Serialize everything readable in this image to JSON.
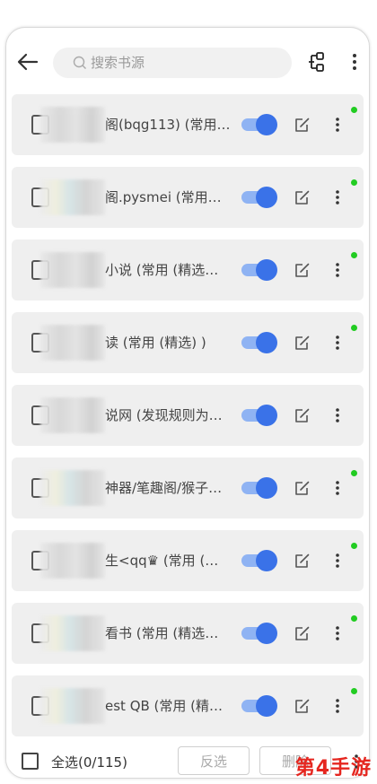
{
  "search": {
    "placeholder": "搜索书源"
  },
  "sources": [
    {
      "name": "阁(bqg113) (常用…",
      "enabled": true,
      "status_dot": true
    },
    {
      "name": "阁.pysmei (常用…",
      "enabled": true,
      "status_dot": true
    },
    {
      "name": "小说 (常用 (精选…",
      "enabled": true,
      "status_dot": true
    },
    {
      "name": "读 (常用 (精选) )",
      "enabled": true,
      "status_dot": true
    },
    {
      "name": "说网 (发现规则为…",
      "enabled": true,
      "status_dot": false
    },
    {
      "name": "神器/笔趣阁/猴子…",
      "enabled": true,
      "status_dot": true
    },
    {
      "name": "生<qq♛ (常用 (…",
      "enabled": true,
      "status_dot": true
    },
    {
      "name": "看书 (常用 (精选…",
      "enabled": true,
      "status_dot": true
    },
    {
      "name": "est QB (常用 (精…",
      "enabled": true,
      "status_dot": true
    }
  ],
  "bottom": {
    "select_all_label": "全选(0/115)",
    "invert_label": "反选",
    "delete_label": "删除"
  },
  "watermark": "第4手游",
  "colors": {
    "accent": "#3a72e8",
    "dot": "#22cc22",
    "row_bg": "#efefef"
  }
}
